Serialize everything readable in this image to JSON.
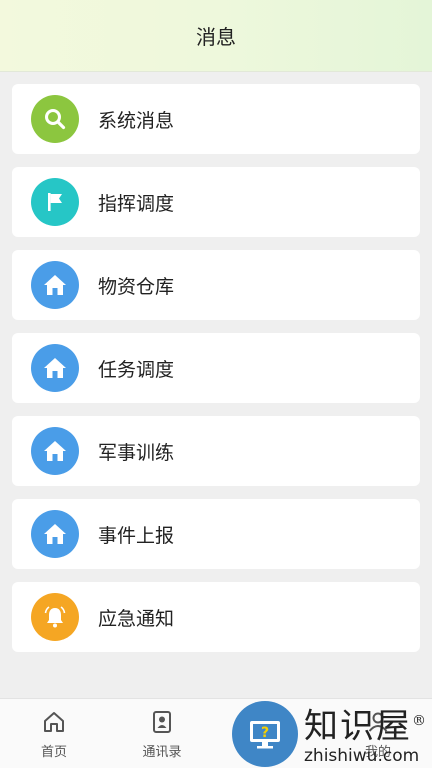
{
  "header": {
    "title": "消息"
  },
  "menu": [
    {
      "label": "系统消息",
      "icon": "search-icon",
      "color": "#8cc63f"
    },
    {
      "label": "指挥调度",
      "icon": "flag-icon",
      "color": "#26c6c6"
    },
    {
      "label": "物资仓库",
      "icon": "home-icon",
      "color": "#4a9de8"
    },
    {
      "label": "任务调度",
      "icon": "home-icon",
      "color": "#4a9de8"
    },
    {
      "label": "军事训练",
      "icon": "home-icon",
      "color": "#4a9de8"
    },
    {
      "label": "事件上报",
      "icon": "home-icon",
      "color": "#4a9de8"
    },
    {
      "label": "应急通知",
      "icon": "bell-icon",
      "color": "#f5a623"
    }
  ],
  "tabbar": {
    "tabs": [
      {
        "label": "首页",
        "icon": "home-outline-icon"
      },
      {
        "label": "通讯录",
        "icon": "contact-icon"
      },
      {
        "label": "",
        "icon": ""
      },
      {
        "label": "我的",
        "icon": "user-icon"
      }
    ]
  },
  "watermark": {
    "cn": "知识屋",
    "en": "zhishiwu.com",
    "mark": "®"
  }
}
